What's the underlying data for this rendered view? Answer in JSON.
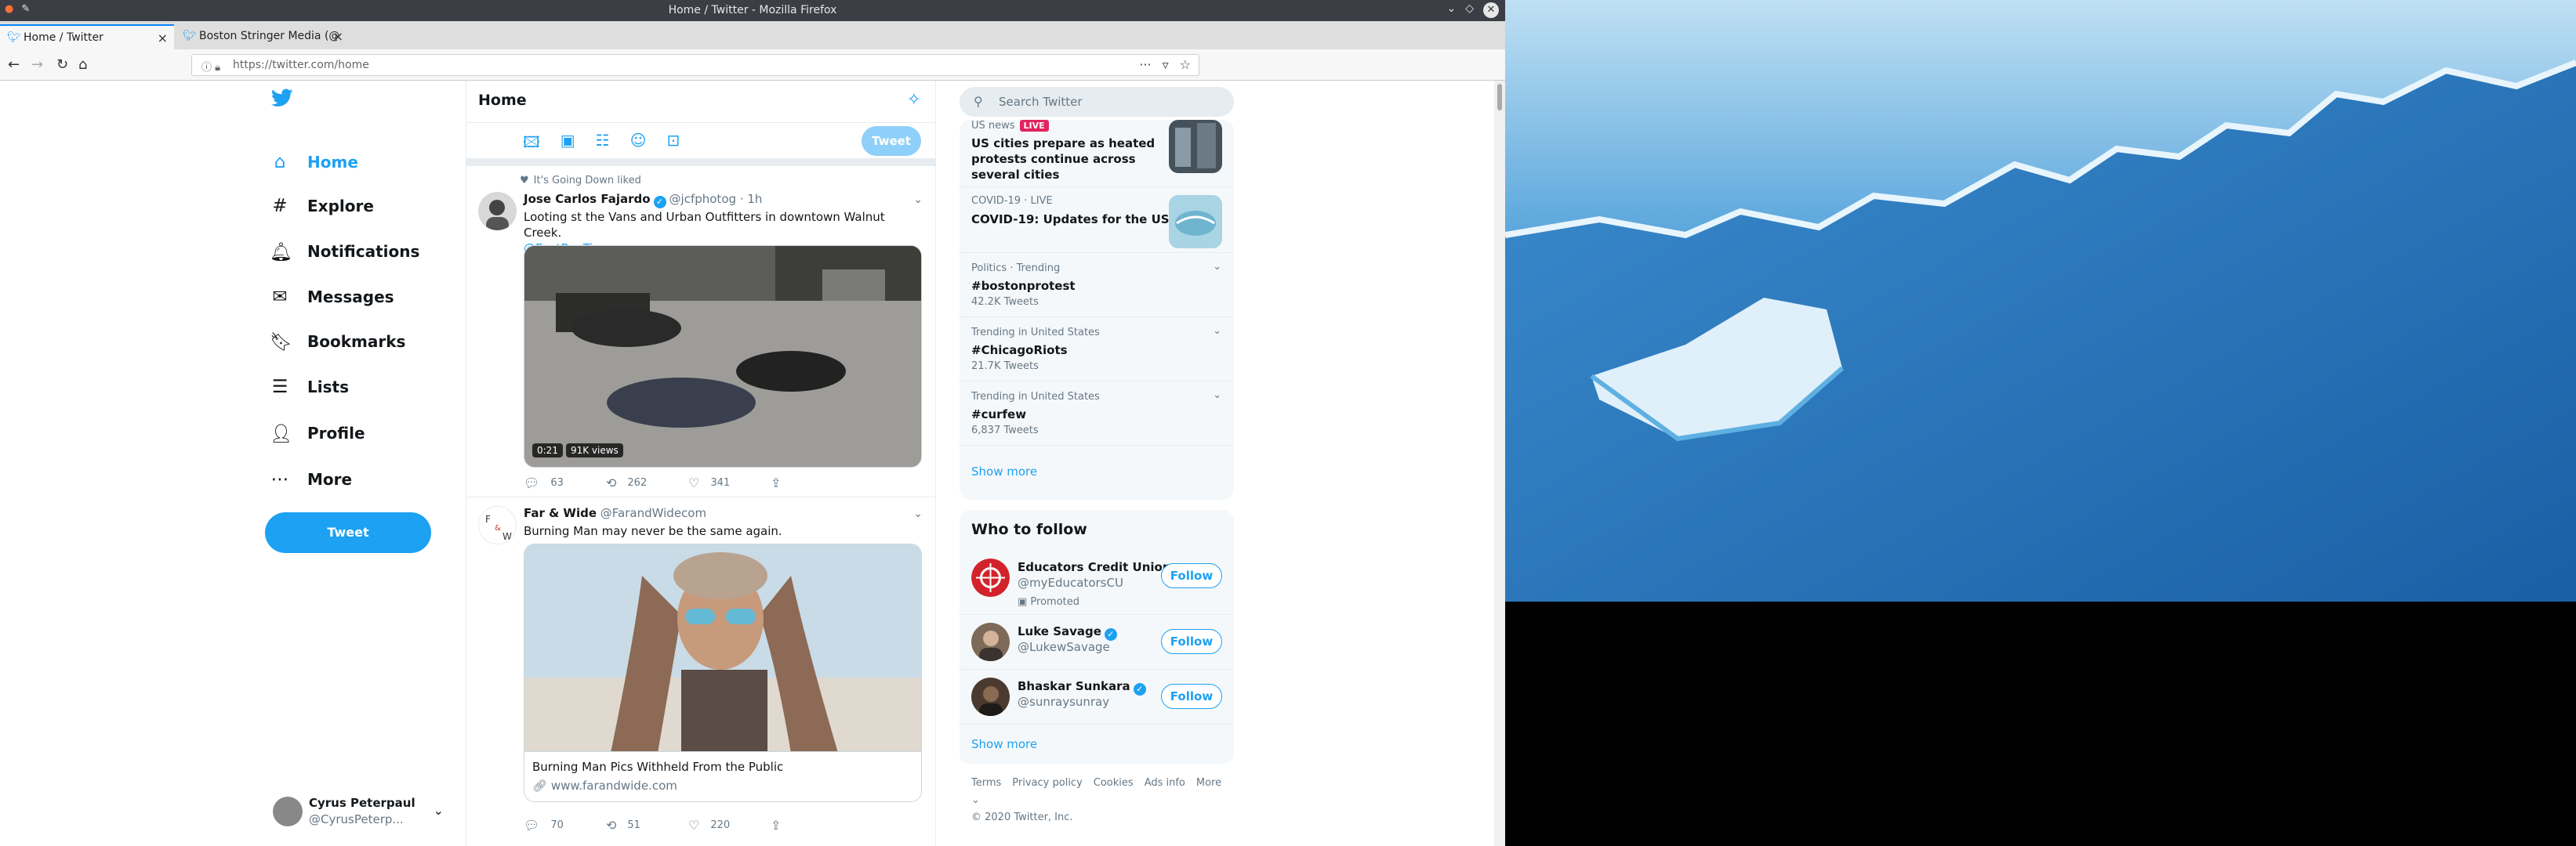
{
  "titlebar": {
    "title": "Home / Twitter - Mozilla Firefox"
  },
  "tabs": [
    {
      "label": "Home / Twitter"
    },
    {
      "label": "Boston Stringer Media (@"
    }
  ],
  "url": {
    "prefix": "https://",
    "rest": "twitter.com/home"
  },
  "nav": {
    "items": [
      {
        "label": "Home",
        "icon": "home-icon"
      },
      {
        "label": "Explore",
        "icon": "hashtag-icon"
      },
      {
        "label": "Notifications",
        "icon": "bell-icon"
      },
      {
        "label": "Messages",
        "icon": "envelope-icon"
      },
      {
        "label": "Bookmarks",
        "icon": "bookmark-icon"
      },
      {
        "label": "Lists",
        "icon": "list-icon"
      },
      {
        "label": "Profile",
        "icon": "person-icon"
      },
      {
        "label": "More",
        "icon": "more-icon"
      }
    ],
    "tweet_button": "Tweet"
  },
  "account": {
    "name": "Cyrus Peterpaul",
    "handle": "@CyrusPeterp..."
  },
  "main": {
    "title": "Home",
    "compose_tweet": "Tweet",
    "tweets": [
      {
        "context": "It's Going Down liked",
        "name": "Jose Carlos Fajardo",
        "handle": "@jcfphotog",
        "time": "· 1h",
        "text": "Looting st the Vans and Urban Outfitters in downtown Walnut Creek.",
        "link": "@EastBayTimes",
        "video_duration": "0:21",
        "video_views": "91K views",
        "replies": "63",
        "retweets": "262",
        "likes": "341"
      },
      {
        "name": "Far & Wide",
        "handle": "@FarandWidecom",
        "text": "Burning Man may never be the same again.",
        "card_title": "Burning Man Pics Withheld From the Public",
        "card_link": "www.farandwide.com",
        "replies": "70",
        "retweets": "51",
        "likes": "220"
      }
    ]
  },
  "right": {
    "search_placeholder": "Search Twitter",
    "trends": [
      {
        "meta": "US news",
        "live": "LIVE",
        "head": "US cities prepare as heated protests continue across several cities"
      },
      {
        "meta": "COVID-19 · LIVE",
        "head": "COVID-19: Updates for the US"
      },
      {
        "meta": "Politics · Trending",
        "head": "#bostonprotest",
        "count": "42.2K Tweets"
      },
      {
        "meta": "Trending in United States",
        "head": "#ChicagoRiots",
        "count": "21.7K Tweets"
      },
      {
        "meta": "Trending in United States",
        "head": "#curfew",
        "count": "6,837 Tweets"
      }
    ],
    "trends_show_more": "Show more",
    "wtf_title": "Who to follow",
    "follow": [
      {
        "name": "Educators Credit Union",
        "handle": "@myEducatorsCU",
        "promoted": "Promoted",
        "button": "Follow"
      },
      {
        "name": "Luke Savage",
        "handle": "@LukewSavage",
        "button": "Follow"
      },
      {
        "name": "Bhaskar Sunkara",
        "handle": "@sunraysunray",
        "button": "Follow"
      }
    ],
    "wtf_show_more": "Show more",
    "footer": {
      "terms": "Terms",
      "privacy": "Privacy policy",
      "cookies": "Cookies",
      "ads": "Ads info",
      "more": "More ⌄",
      "copy": "© 2020 Twitter, Inc."
    }
  }
}
